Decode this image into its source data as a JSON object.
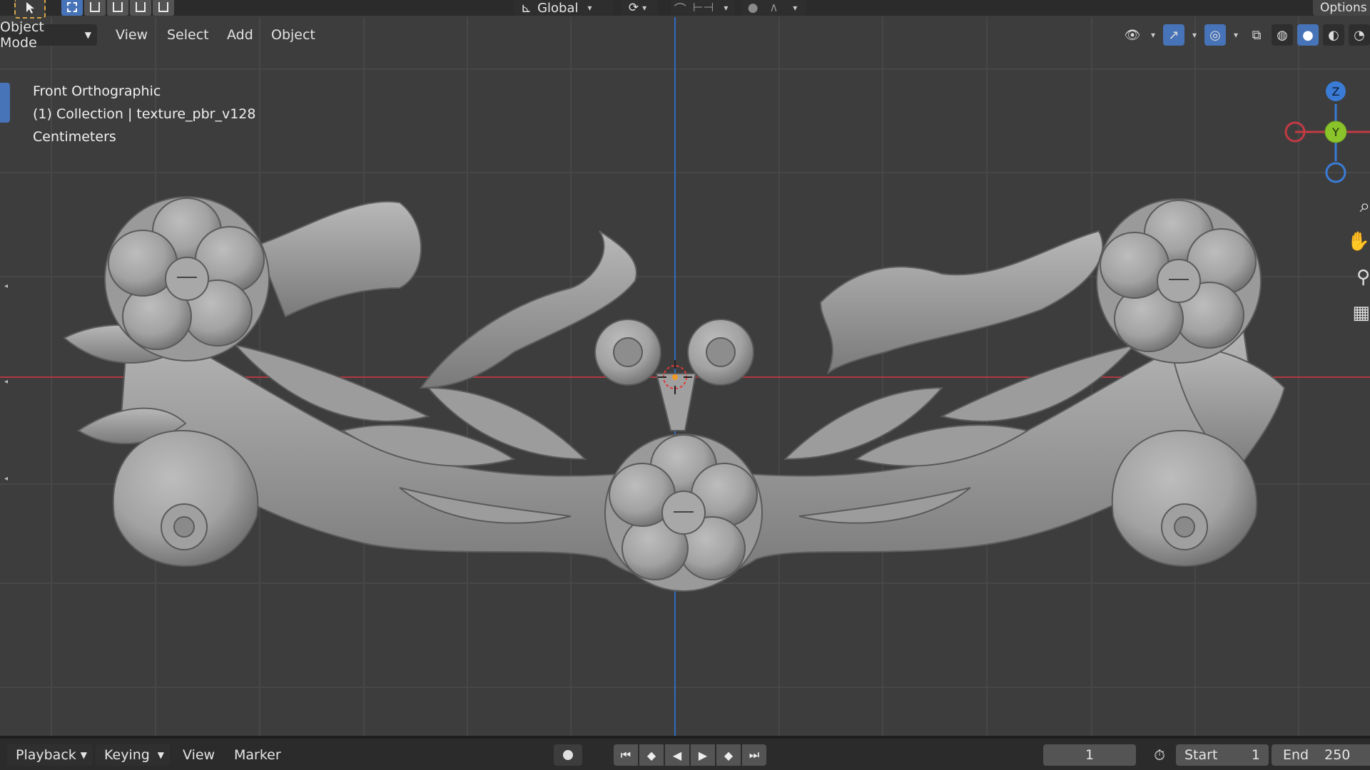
{
  "toolbar": {
    "orientation_label": "Global",
    "options_label": "Options"
  },
  "header": {
    "mode_label": "Object Mode",
    "menus": [
      "View",
      "Select",
      "Add",
      "Object"
    ]
  },
  "viewport": {
    "view_name": "Front Orthographic",
    "collection_info": "(1) Collection | texture_pbr_v128",
    "units": "Centimeters",
    "gizmo": {
      "z_label": "Z",
      "y_label": "Y"
    }
  },
  "timeline": {
    "playback_label": "Playback",
    "keying_label": "Keying",
    "view_label": "View",
    "marker_label": "Marker",
    "current_frame": "1",
    "start_label": "Start",
    "start_value": "1",
    "end_label": "End",
    "end_value": "250"
  },
  "colors": {
    "accent": "#4773b8",
    "x_axis": "#c23a44",
    "y_axis": "#8bc32b",
    "z_axis": "#3a7bd5",
    "viewport_bg": "#3d3d3d"
  }
}
